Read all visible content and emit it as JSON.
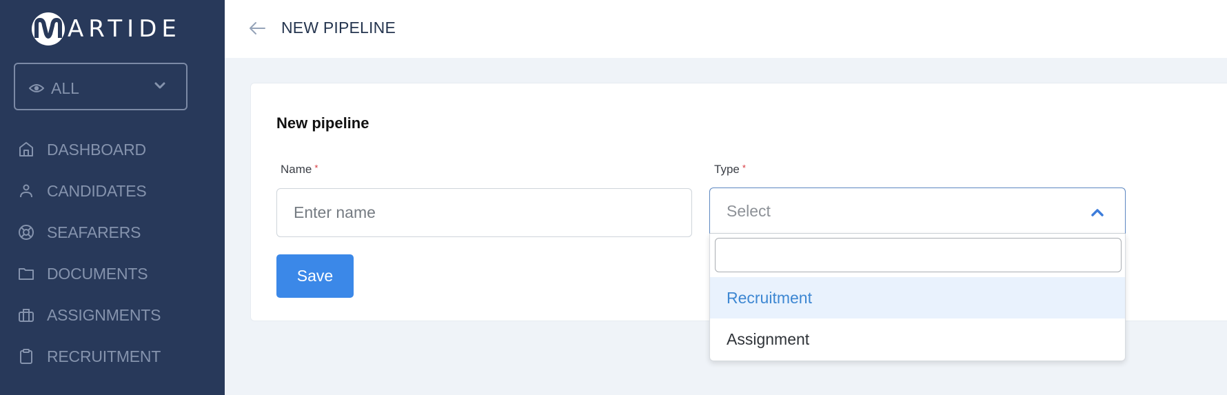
{
  "app": {
    "logo_text": "ARTIDE",
    "logo_letter": "M",
    "brand_colors": {
      "sidebar": "#28395a",
      "primary": "#3b88e8",
      "background": "#eff3f8"
    }
  },
  "sidebar": {
    "filter": {
      "icon": "eye-icon",
      "label": "ALL",
      "chevron": "chevron-down-icon"
    },
    "items": [
      {
        "label": "DASHBOARD",
        "icon": "home-icon"
      },
      {
        "label": "CANDIDATES",
        "icon": "user-icon"
      },
      {
        "label": "SEAFARERS",
        "icon": "lifebuoy-icon"
      },
      {
        "label": "DOCUMENTS",
        "icon": "folder-icon"
      },
      {
        "label": "ASSIGNMENTS",
        "icon": "briefcase-icon"
      },
      {
        "label": "RECRUITMENT",
        "icon": "clipboard-icon"
      }
    ]
  },
  "header": {
    "back_icon": "arrow-left-icon",
    "title": "NEW PIPELINE"
  },
  "form": {
    "title": "New pipeline",
    "name": {
      "label": "Name",
      "required_mark": "*",
      "value": "",
      "placeholder": "Enter name"
    },
    "type": {
      "label": "Type",
      "required_mark": "*",
      "placeholder": "Select",
      "open": true,
      "search_value": "",
      "options": [
        {
          "label": "Recruitment",
          "highlighted": true
        },
        {
          "label": "Assignment",
          "highlighted": false
        }
      ]
    },
    "save_label": "Save"
  }
}
